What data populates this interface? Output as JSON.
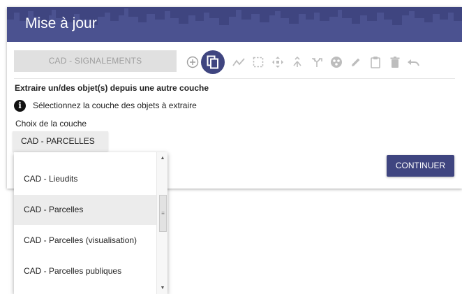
{
  "header": {
    "title": "Mise à jour"
  },
  "layer": {
    "current": "CAD - SIGNALEMENTS"
  },
  "toolbar": {
    "tools": [
      {
        "icon": "add-circle-icon"
      },
      {
        "icon": "copy-icon",
        "active": true
      },
      {
        "icon": "polyline-icon"
      },
      {
        "icon": "select-area-icon"
      },
      {
        "icon": "move-icon"
      },
      {
        "icon": "merge-icon"
      },
      {
        "icon": "split-icon"
      },
      {
        "icon": "vertex-icon"
      },
      {
        "icon": "edit-pencil-icon"
      },
      {
        "icon": "clipboard-icon"
      },
      {
        "icon": "delete-icon"
      },
      {
        "icon": "undo-icon"
      }
    ]
  },
  "action": {
    "title": "Extraire un/des objet(s) depuis une autre couche",
    "info": "Sélectionnez la couche des objets à extraire",
    "info_glyph": "i"
  },
  "layer_choice": {
    "label": "Choix de la couche",
    "selected": "CAD - PARCELLES",
    "options": [
      "CAD - Lieudits",
      "CAD - Parcelles",
      "CAD - Parcelles (visualisation)",
      "CAD - Parcelles publiques"
    ],
    "selected_index": 1
  },
  "buttons": {
    "continue": "CONTINUER"
  },
  "colors": {
    "primary": "#3f4580",
    "header_skyline": "#4c5490"
  }
}
